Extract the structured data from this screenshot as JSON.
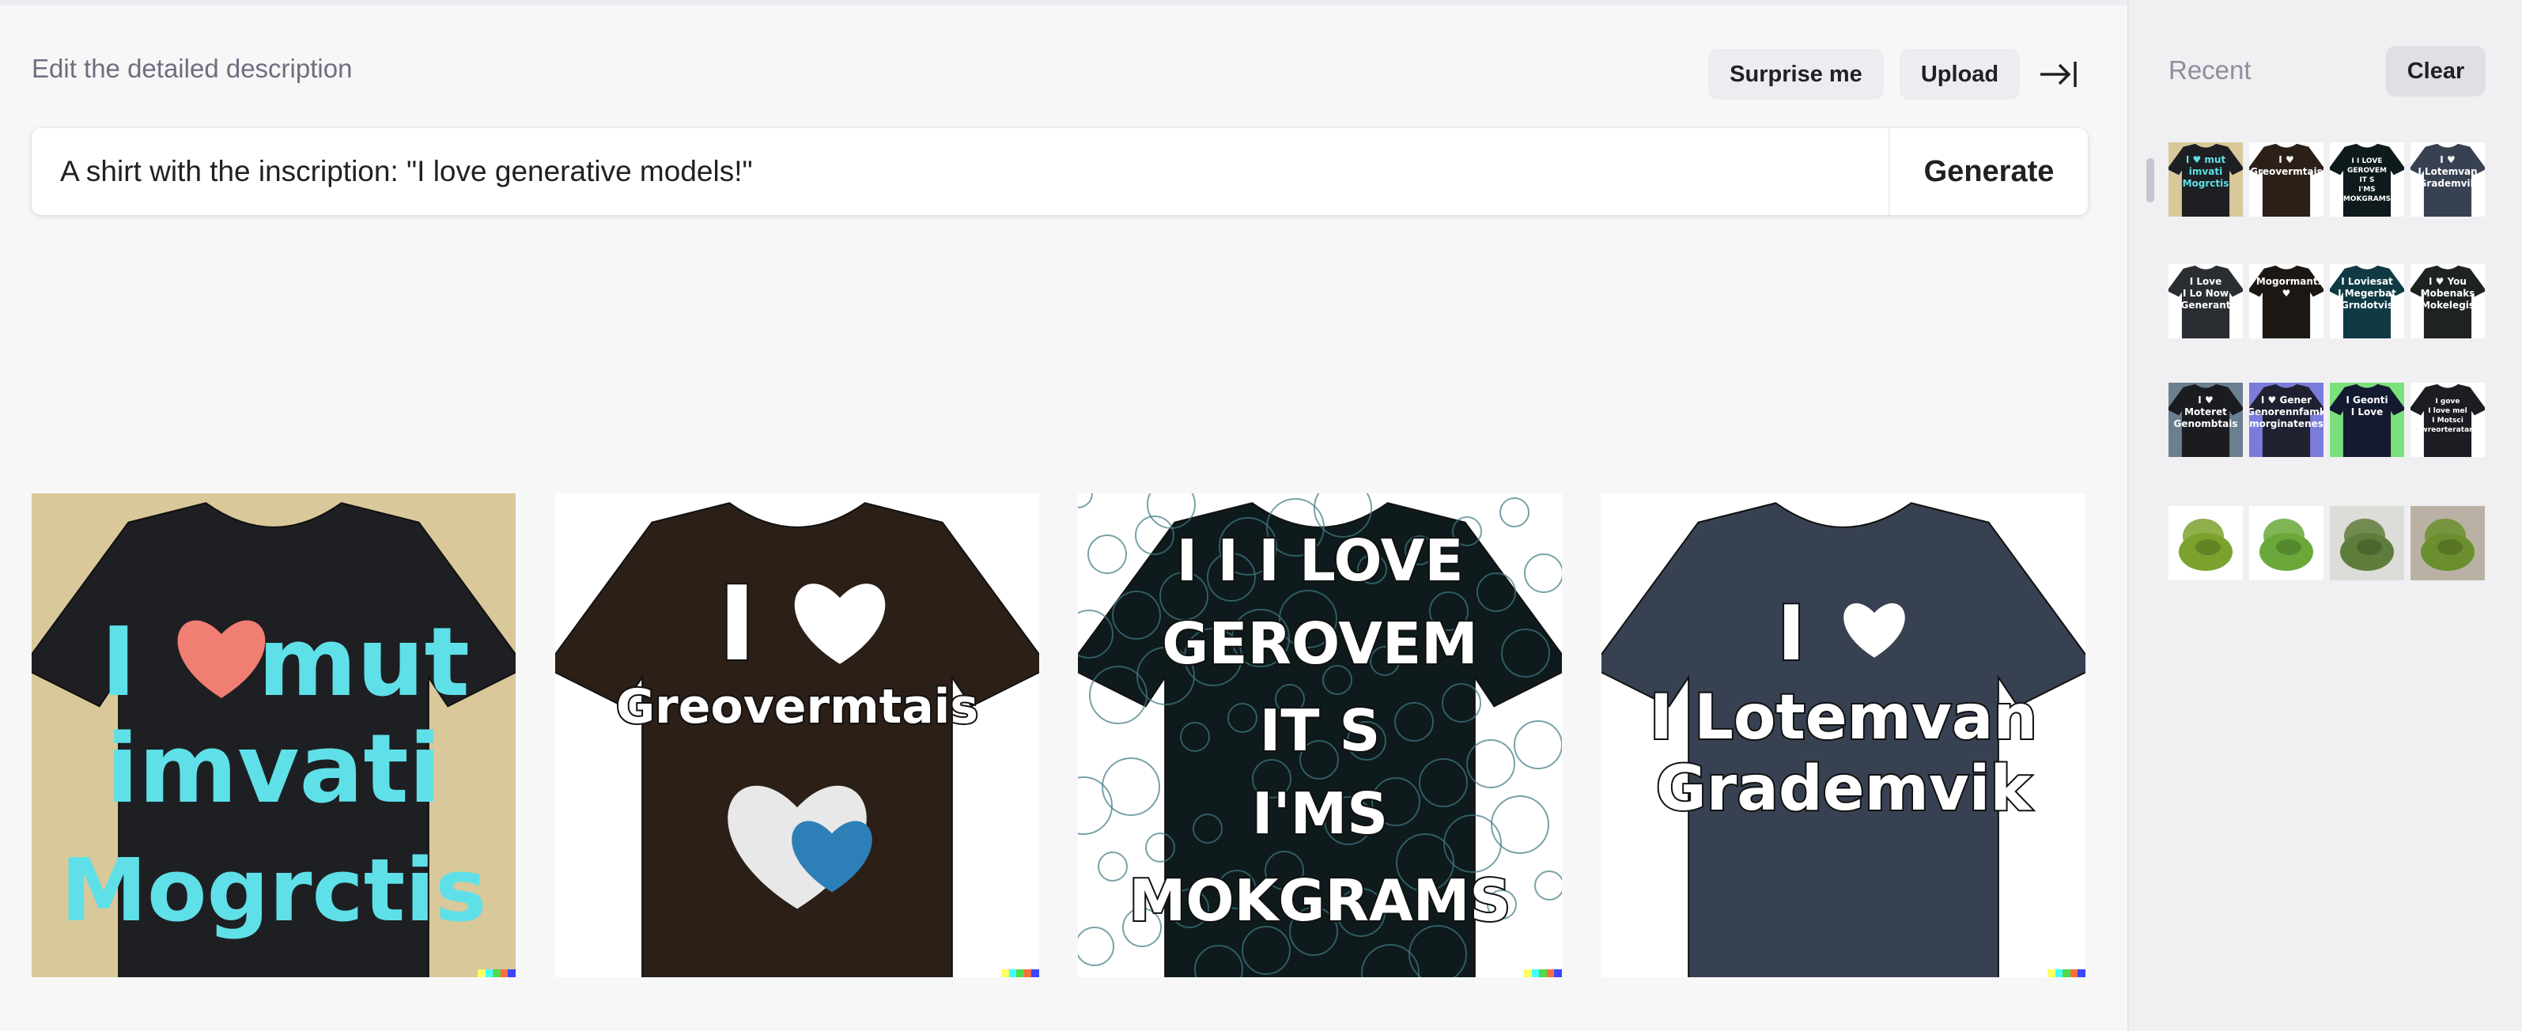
{
  "editor": {
    "label": "Edit the detailed description",
    "surprise_label": "Surprise me",
    "upload_label": "Upload",
    "prompt_value": "A shirt with the inscription: \"I love generative models!\"",
    "generate_label": "Generate"
  },
  "results": [
    {
      "shirt_color": "#1d1f22",
      "bg": "#d9c89a",
      "text_color": "#5fe0e8",
      "lines": [
        "I",
        "mut",
        "imvati",
        "Mogrctis"
      ]
    },
    {
      "shirt_color": "#2b1f17",
      "bg": "#ffffff",
      "text_color": "#ffffff",
      "lines": [
        "I",
        "Greovermtais"
      ]
    },
    {
      "shirt_color": "#0e1a1c",
      "bg": "#ffffff",
      "text_color": "#ffffff",
      "lines": [
        "I I  I LOVE",
        "GEROVEM",
        "IT S",
        "I'MS",
        "MOKGRAMS"
      ]
    },
    {
      "shirt_color": "#384152",
      "bg": "#ffffff",
      "text_color": "#ffffff",
      "lines": [
        "I",
        "I Lotemvan",
        "Grademvik"
      ]
    }
  ],
  "signature_colors": [
    "#ffff66",
    "#42ffff",
    "#51da4c",
    "#ff6e3c",
    "#3c46ff"
  ],
  "recent": {
    "title": "Recent",
    "clear_label": "Clear",
    "rows": [
      [
        {
          "kind": "shirt",
          "c": "#1d1f22",
          "bg": "#d9c89a",
          "t": "I ♥ mut\nimvati\nMogrctis",
          "tc": "#5fe0e8"
        },
        {
          "kind": "shirt",
          "c": "#2b1f17",
          "bg": "#ffffff",
          "t": "I ♥\nGreovermtais",
          "tc": "#ffffff"
        },
        {
          "kind": "shirt",
          "c": "#0e1a1c",
          "bg": "#ffffff",
          "t": "I I LOVE\nGEROVEM\nIT S\nI'MS\nMOKGRAMS",
          "tc": "#ffffff"
        },
        {
          "kind": "shirt",
          "c": "#384152",
          "bg": "#ffffff",
          "t": "I ♥\nI Lotemvan\nGrademvik",
          "tc": "#ffffff"
        }
      ],
      [
        {
          "kind": "shirt",
          "c": "#2a2e33",
          "bg": "#ffffff",
          "t": "I Love\nI Lo Now\nGenerant",
          "tc": "#ffffff"
        },
        {
          "kind": "shirt",
          "c": "#1c1712",
          "bg": "#ffffff",
          "t": "I Mogormants\n♥",
          "tc": "#ffffff"
        },
        {
          "kind": "shirt",
          "c": "#0f3a44",
          "bg": "#ffffff",
          "t": "I Loviesat\nI Megerbat\nGrndotvis",
          "tc": "#ffffff"
        },
        {
          "kind": "shirt",
          "c": "#1e2320",
          "bg": "#ffffff",
          "t": "I ♥ You\nMobenaks\nMokelegis",
          "tc": "#ffffff"
        }
      ],
      [
        {
          "kind": "shirt",
          "c": "#1a1c20",
          "bg": "#6a7f8f",
          "t": "I ♥\nMoteret\nGenombtais",
          "tc": "#ffffff"
        },
        {
          "kind": "shirt",
          "c": "#1f2130",
          "bg": "#7b7bd9",
          "t": "I ♥ Gener\nGenorennfamk\nmorginatenes",
          "tc": "#ffffff"
        },
        {
          "kind": "shirt",
          "c": "#141a30",
          "bg": "#7be07b",
          "t": "I Geonti\nI Love",
          "tc": "#ffffff"
        },
        {
          "kind": "shirt",
          "c": "#1b1d22",
          "bg": "#ffffff",
          "t": "I gove\nI love mel\nI Motsci\nwreorteratan",
          "tc": "#ffffff"
        }
      ],
      [
        {
          "kind": "chair",
          "c": "#7ba22d",
          "bg": "#ffffff"
        },
        {
          "kind": "chair",
          "c": "#6aa83a",
          "bg": "#ffffff"
        },
        {
          "kind": "chair",
          "c": "#5e7d3b",
          "bg": "#dcdcd8"
        },
        {
          "kind": "chair",
          "c": "#6b8f2e",
          "bg": "#b9b2a4"
        }
      ]
    ]
  }
}
